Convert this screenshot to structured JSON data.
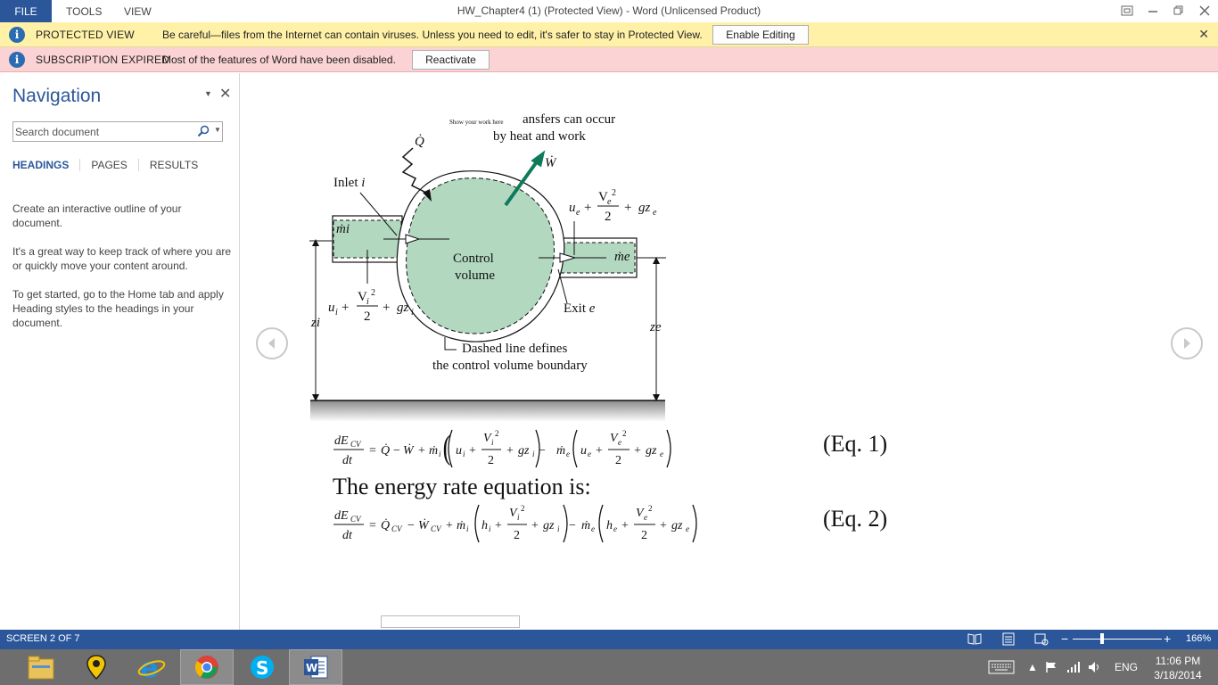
{
  "window": {
    "title": "HW_Chapter4 (1) (Protected View) - Word (Unlicensed Product)",
    "menu": [
      "FILE",
      "TOOLS",
      "VIEW"
    ]
  },
  "protected_bar": {
    "label": "PROTECTED VIEW",
    "message": "Be careful—files from the Internet can contain viruses. Unless you need to edit, it's safer to stay in Protected View.",
    "button": "Enable Editing"
  },
  "subscription_bar": {
    "label": "SUBSCRIPTION EXPIRED",
    "message": "Most of the features of Word have been disabled.",
    "button": "Reactivate"
  },
  "navigation": {
    "title": "Navigation",
    "search_placeholder": "Search document",
    "tabs": [
      "HEADINGS",
      "PAGES",
      "RESULTS"
    ],
    "help": [
      "Create an interactive outline of your document.",
      "It's a great way to keep track of where you are or quickly move your content around.",
      "To get started, go to the Home tab and apply Heading styles to the headings in your document."
    ]
  },
  "document": {
    "figure": {
      "show_work": "Show your work here",
      "caption_top_1": "ansfers can occur",
      "caption_top_2": "by heat and work",
      "q_dot": "Q̇",
      "w_dot": "Ẇ",
      "inlet": "Inlet",
      "inlet_var": "i",
      "mi": "ṁi",
      "me": "ṁe",
      "control_volume_1": "Control",
      "control_volume_2": "volume",
      "exit": "Exit",
      "exit_var": "e",
      "zi": "zi",
      "ze": "ze",
      "dashed_line_1": "Dashed line defines",
      "dashed_line_2": "the control volume boundary"
    },
    "eq1_label": "(Eq. 1)",
    "energy_rate_text": "The energy rate equation is:",
    "eq2_label": "(Eq. 2)"
  },
  "status": {
    "screen": "SCREEN 2 OF 7",
    "zoom": "166%",
    "zoom_level": 0.33
  },
  "taskbar": {
    "language": "ENG",
    "time": "11:06 PM",
    "date": "3/18/2014"
  },
  "colors": {
    "accent": "#2b579a",
    "protected_bar": "#fff1a8",
    "subscription_bar": "#fbd3d4",
    "control_volume_fill": "#b2d8c0",
    "arrow_green": "#0e7a5a"
  }
}
